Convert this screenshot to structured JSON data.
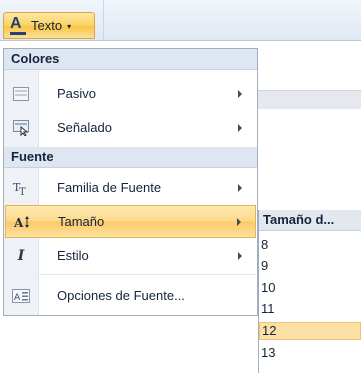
{
  "ribbon": {
    "texto_button": {
      "label": "Texto",
      "icon": "text-color-a-icon",
      "caret": "▾"
    }
  },
  "menu": {
    "section_colores": "Colores",
    "pasivo": {
      "label": "Pasivo",
      "icon": "palette-passive-icon"
    },
    "senalado": {
      "label": "Señalado",
      "icon": "palette-hover-icon"
    },
    "section_fuente": "Fuente",
    "familia": {
      "label": "Familia de Fuente",
      "icon": "font-family-icon"
    },
    "tamano": {
      "label": "Tamaño",
      "icon": "font-size-icon"
    },
    "estilo": {
      "label": "Estilo",
      "icon": "italic-icon"
    },
    "opciones": {
      "label": "Opciones de Fuente...",
      "icon": "font-options-icon"
    }
  },
  "submenu": {
    "title": "Tamaño d...",
    "sizes": [
      "8",
      "9",
      "10",
      "11",
      "12",
      "13"
    ],
    "selected": "12"
  },
  "colors": {
    "accent": "#fbd56c",
    "section": "#dde6f1",
    "text": "#15233d"
  }
}
